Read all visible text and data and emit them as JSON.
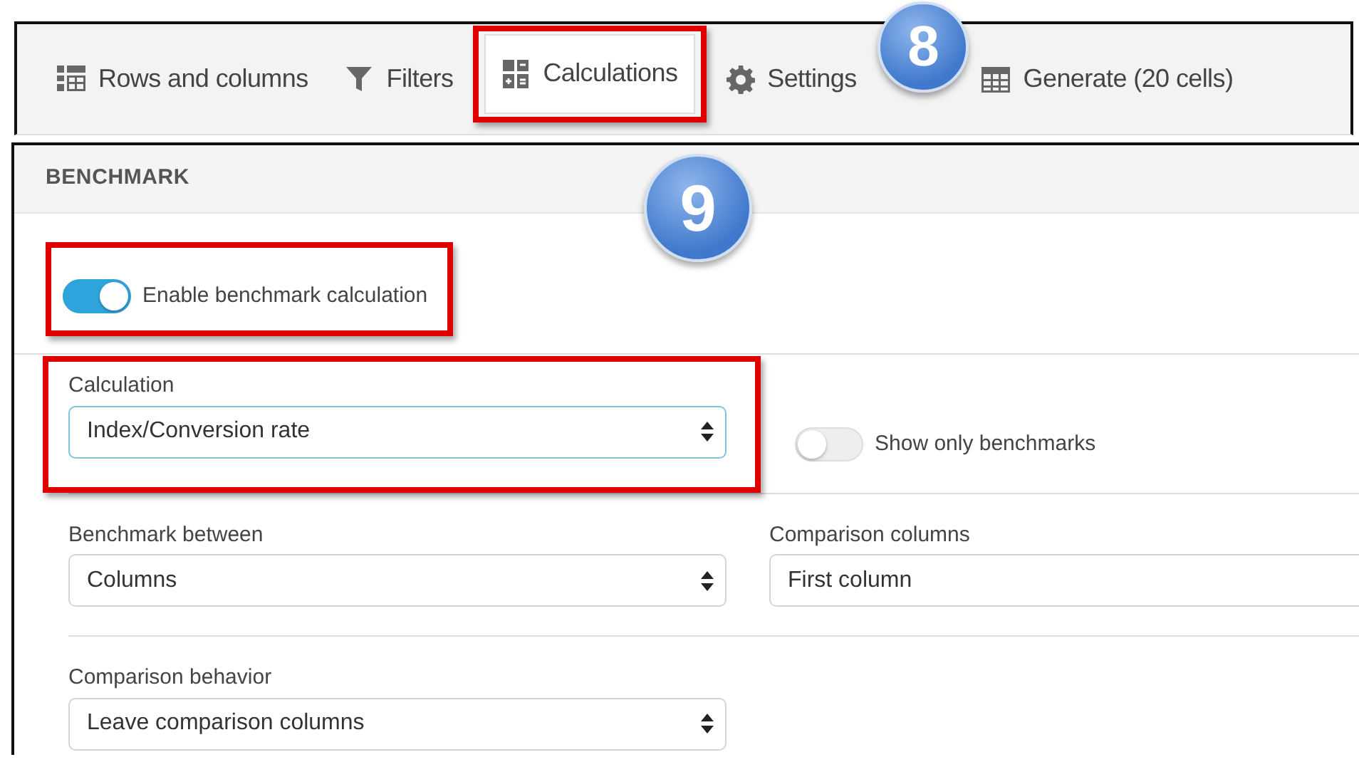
{
  "tabs": [
    {
      "label": "Rows and columns",
      "selected": false,
      "highlighted": false
    },
    {
      "label": "Filters",
      "selected": false,
      "highlighted": false
    },
    {
      "label": "Calculations",
      "selected": true,
      "highlighted": true
    },
    {
      "label": "Settings",
      "selected": false,
      "highlighted": false
    },
    {
      "label": "Generate (20 cells)",
      "selected": false,
      "highlighted": false
    }
  ],
  "callouts": [
    "8",
    "9"
  ],
  "section": {
    "title": "BENCHMARK"
  },
  "enable_toggle": {
    "label": "Enable benchmark calculation",
    "on": true,
    "highlighted": true
  },
  "calculation": {
    "label": "Calculation",
    "value": "Index/Conversion rate",
    "focused": true,
    "highlighted": true
  },
  "show_only_toggle": {
    "label": "Show only benchmarks",
    "on": false
  },
  "benchmark_between": {
    "label": "Benchmark between",
    "value": "Columns"
  },
  "comparison_columns": {
    "label": "Comparison columns",
    "value": "First column"
  },
  "comparison_behavior": {
    "label": "Comparison behavior",
    "value": "Leave comparison columns"
  }
}
